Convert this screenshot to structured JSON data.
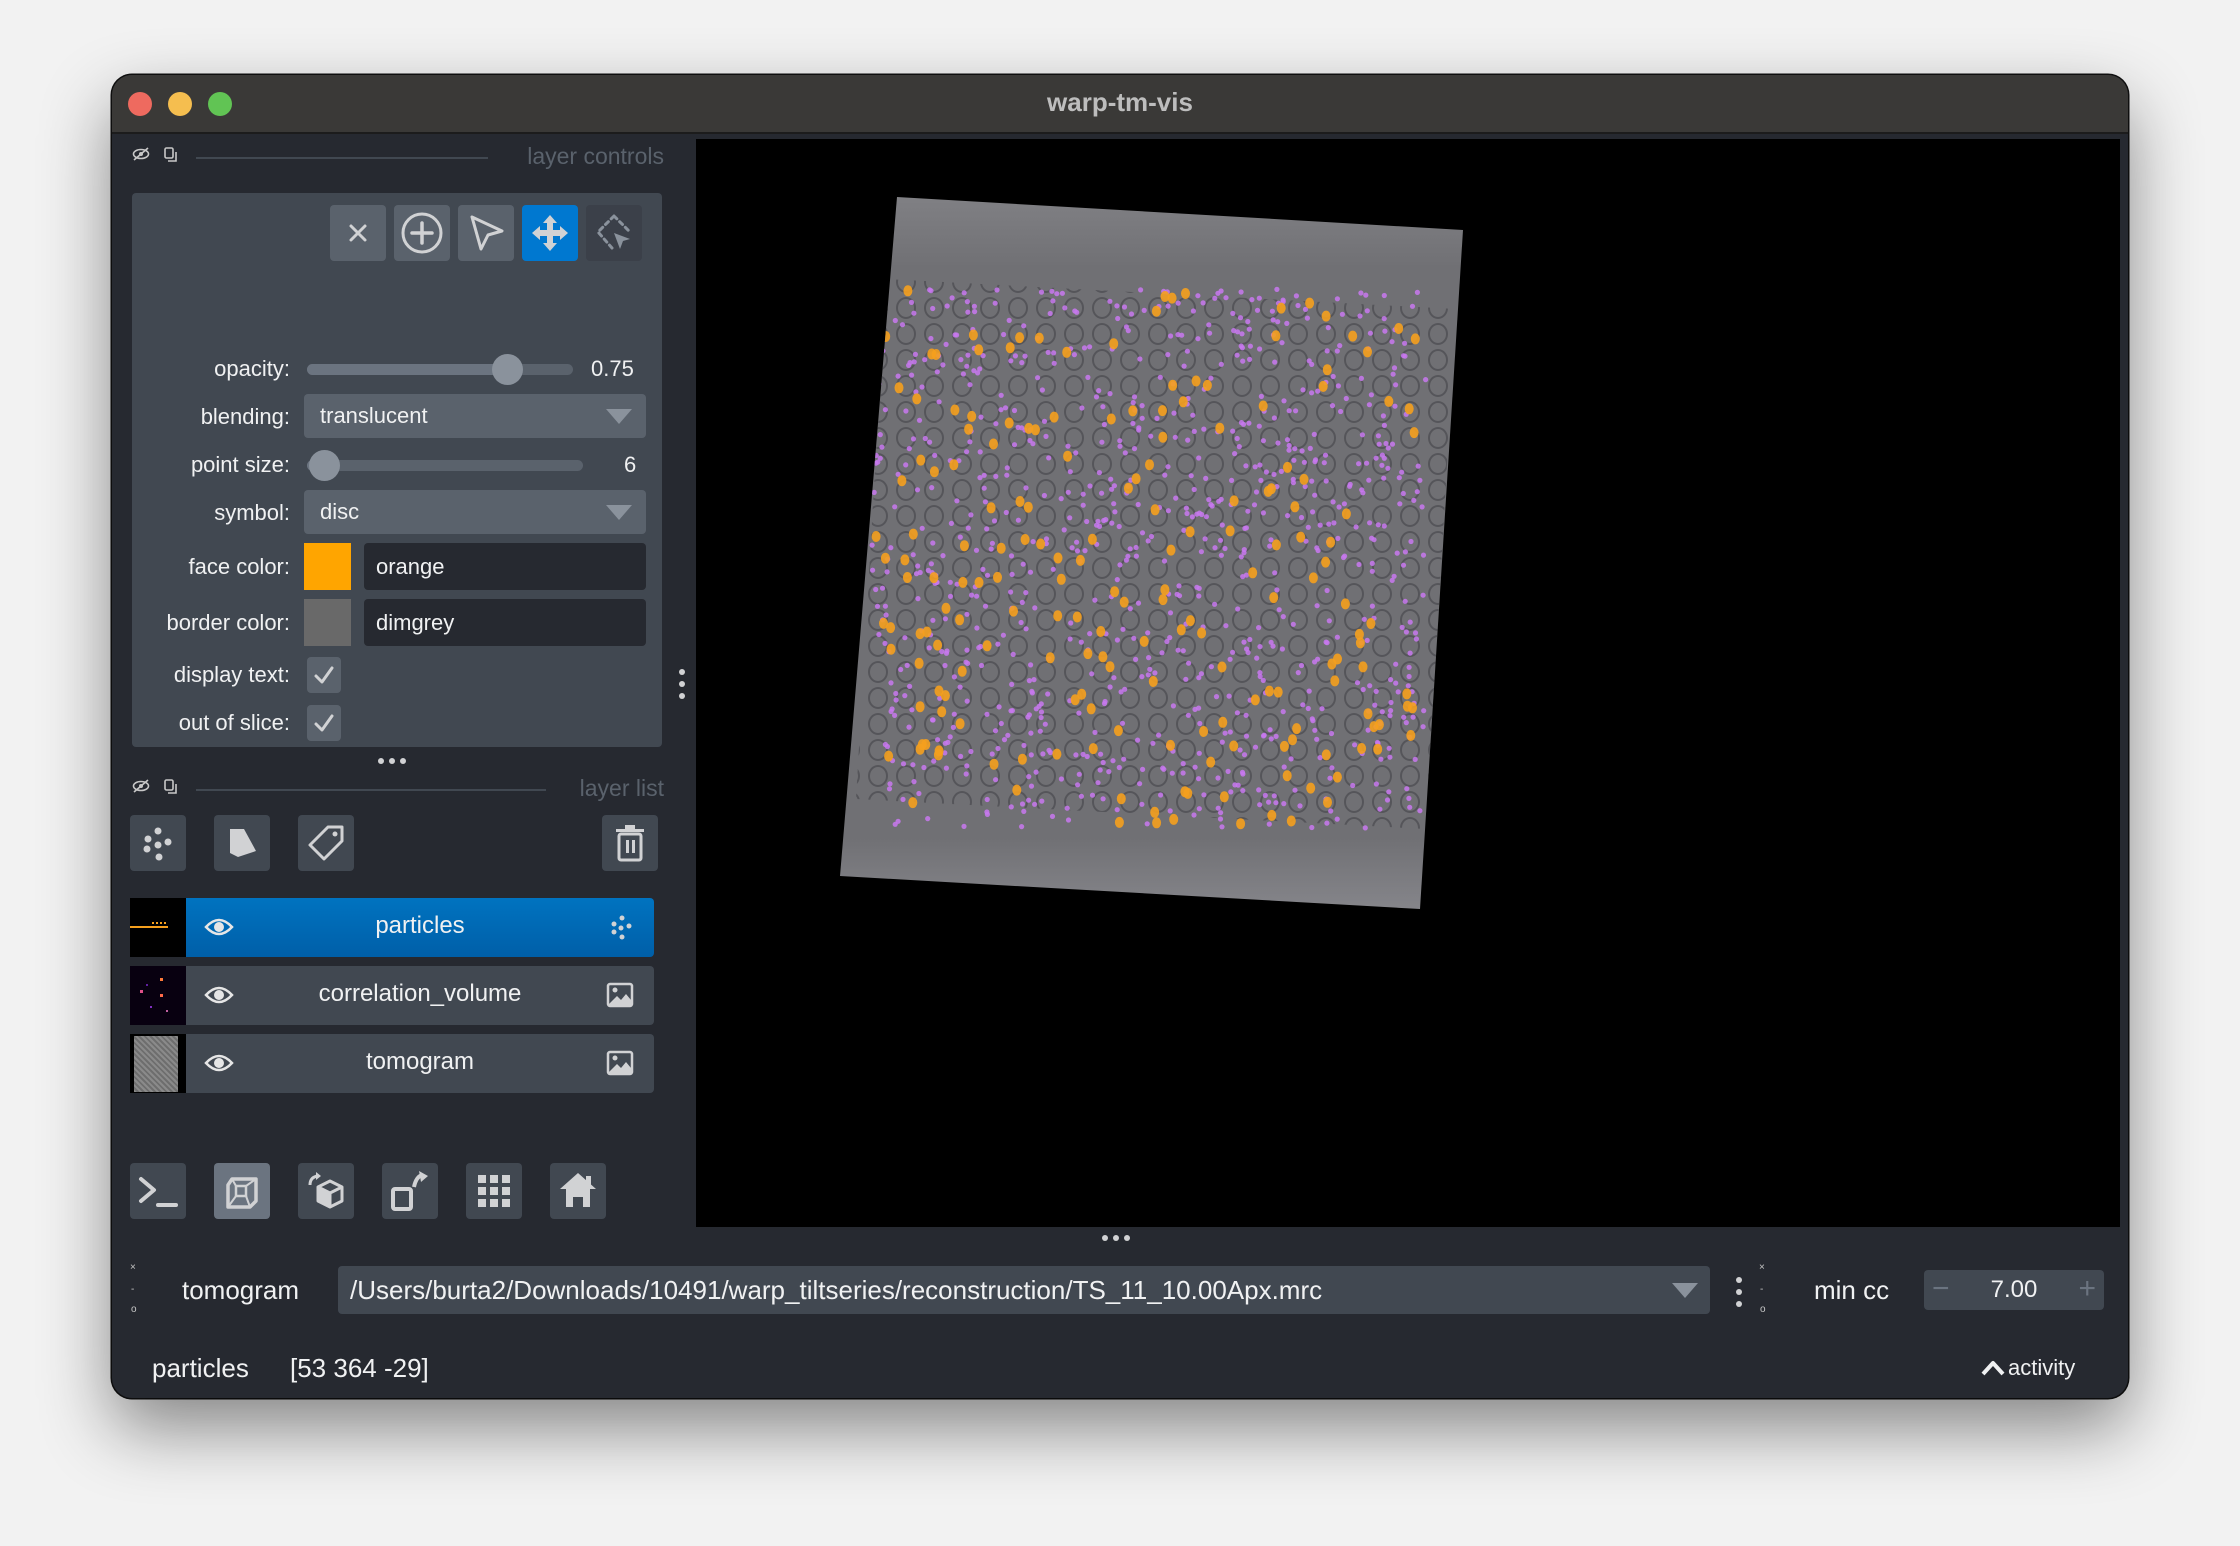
{
  "window": {
    "title": "warp-tm-vis"
  },
  "layer_controls": {
    "header": "layer controls",
    "tools": [
      {
        "name": "delete-selected-points",
        "icon": "close-icon",
        "active": false
      },
      {
        "name": "add-points",
        "icon": "add-circle-icon",
        "active": false
      },
      {
        "name": "select-points",
        "icon": "pointer-icon",
        "active": false
      },
      {
        "name": "pan-zoom",
        "icon": "move-icon",
        "active": true
      },
      {
        "name": "transform",
        "icon": "transform-select-icon",
        "active": false
      }
    ],
    "opacity": {
      "label": "opacity:",
      "value": "0.75",
      "fraction": 0.75
    },
    "blending": {
      "label": "blending:",
      "value": "translucent"
    },
    "point_size": {
      "label": "point size:",
      "value": "6",
      "fraction": 0.06
    },
    "symbol": {
      "label": "symbol:",
      "value": "disc"
    },
    "face_color": {
      "label": "face color:",
      "value": "orange",
      "swatch": "#ffa500"
    },
    "border_color": {
      "label": "border color:",
      "value": "dimgrey",
      "swatch": "#696969"
    },
    "display_text": {
      "label": "display text:",
      "checked": true
    },
    "out_of_slice": {
      "label": "out of slice:",
      "checked": true
    }
  },
  "layer_list": {
    "header": "layer list",
    "buttons": [
      "new-points-layer",
      "new-shapes-layer",
      "new-labels-layer",
      "delete-layer"
    ],
    "layers": [
      {
        "name": "particles",
        "type": "points",
        "visible": true,
        "selected": true
      },
      {
        "name": "correlation_volume",
        "type": "image",
        "visible": true,
        "selected": false
      },
      {
        "name": "tomogram",
        "type": "image",
        "visible": true,
        "selected": false
      }
    ]
  },
  "viewer_buttons": [
    "console",
    "ndisplay-3d",
    "roll-dims",
    "transpose-dims",
    "grid-view",
    "reset-view"
  ],
  "bottom_widget": {
    "layer_label": "tomogram",
    "path_value": "/Users/burta2/Downloads/10491/warp_tiltseries/reconstruction/TS_11_10.00Apx.mrc",
    "min_cc_label": "min cc",
    "min_cc_value": "7.00",
    "minus": "−",
    "plus": "+",
    "dock_x": "×",
    "dock_dash": "-",
    "dock_o": "o"
  },
  "status_bar": {
    "layer": "particles",
    "coords": "[53 364 -29]",
    "activity": "activity"
  },
  "colors": {
    "accent": "#0078d0",
    "particle": "#f5a01e",
    "correlation": "#c878f0"
  }
}
